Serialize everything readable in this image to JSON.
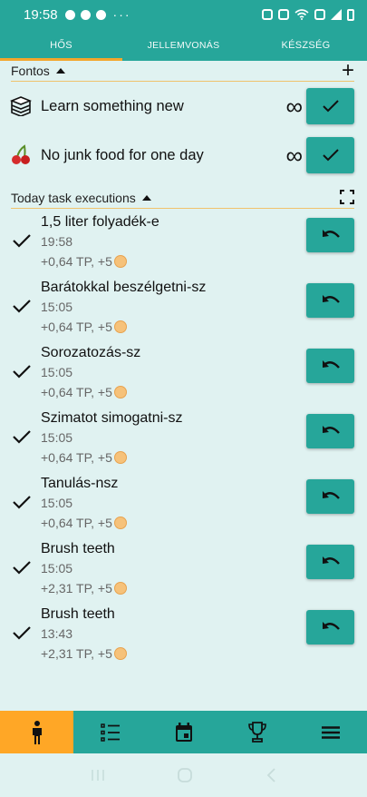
{
  "status_bar": {
    "time": "19:58",
    "overflow": "···",
    "left_icons": [
      "messenger-icon",
      "snapchat-icon",
      "snapchat-icon"
    ],
    "right_icons": [
      "alarm-icon",
      "mute-icon",
      "wifi-icon",
      "volte-icon",
      "signal-icon",
      "battery-icon"
    ]
  },
  "tabs": [
    {
      "label": "HŐS",
      "active": true
    },
    {
      "label": "JELLEMVONÁS",
      "active": false
    },
    {
      "label": "KÉSZSÉG",
      "active": false
    }
  ],
  "important": {
    "header": "Fontos",
    "add_icon": "plus-icon",
    "habits": [
      {
        "title": "Learn something new",
        "icon": "books-icon",
        "repeat": "∞"
      },
      {
        "title": "No junk food for one day",
        "icon": "cherries-icon",
        "repeat": "∞"
      }
    ]
  },
  "executions": {
    "header": "Today task executions",
    "fullscreen_icon": "fullscreen-icon",
    "items": [
      {
        "name": "1,5 liter folyadék-e",
        "time": "19:58",
        "reward": "+0,64 TP, +5"
      },
      {
        "name": "Barátokkal beszélgetni-sz",
        "time": "15:05",
        "reward": "+0,64 TP, +5"
      },
      {
        "name": "Sorozatozás-sz",
        "time": "15:05",
        "reward": "+0,64 TP, +5"
      },
      {
        "name": "Szimatot simogatni-sz",
        "time": "15:05",
        "reward": "+0,64 TP, +5"
      },
      {
        "name": "Tanulás-nsz",
        "time": "15:05",
        "reward": "+0,64 TP, +5"
      },
      {
        "name": "Brush teeth",
        "time": "15:05",
        "reward": "+2,31 TP, +5"
      },
      {
        "name": "Brush teeth",
        "time": "13:43",
        "reward": "+2,31 TP, +5"
      }
    ]
  },
  "bottom_nav": [
    {
      "icon": "person-icon",
      "active": true
    },
    {
      "icon": "list-icon",
      "active": false
    },
    {
      "icon": "calendar-icon",
      "active": false
    },
    {
      "icon": "trophy-icon",
      "active": false
    },
    {
      "icon": "menu-icon",
      "active": false
    }
  ],
  "colors": {
    "primary": "#26a69a",
    "accent": "#ffa726",
    "background": "#e0f2f1",
    "coin": "#f6c27a"
  }
}
